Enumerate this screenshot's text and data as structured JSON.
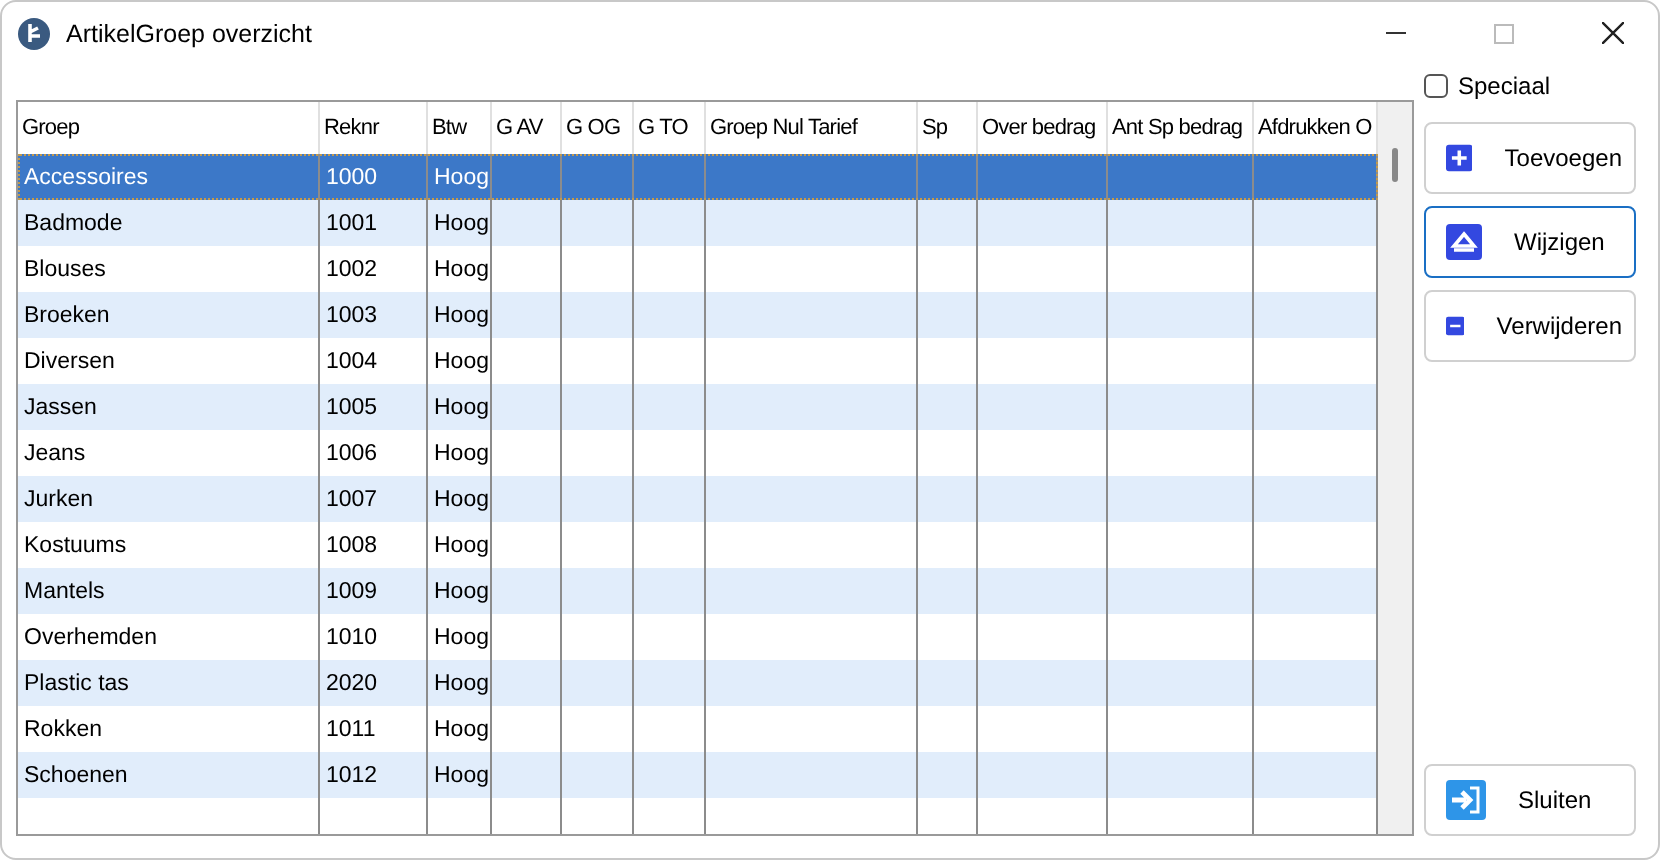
{
  "window": {
    "title": "ArtikelGroep overzicht"
  },
  "table": {
    "columns": [
      "Groep",
      "Reknr",
      "Btw",
      "G AV",
      "G OG",
      "G TO",
      "Groep Nul Tarief",
      "Sp",
      "Over bedrag",
      "Ant Sp bedrag",
      "Afdrukken O"
    ],
    "rows": [
      {
        "cells": [
          "Accessoires",
          "1000",
          "Hoog"
        ],
        "selected": true
      },
      {
        "cells": [
          "Badmode",
          "1001",
          "Hoog"
        ],
        "selected": false
      },
      {
        "cells": [
          "Blouses",
          "1002",
          "Hoog"
        ],
        "selected": false
      },
      {
        "cells": [
          "Broeken",
          "1003",
          "Hoog"
        ],
        "selected": false
      },
      {
        "cells": [
          "Diversen",
          "1004",
          "Hoog"
        ],
        "selected": false
      },
      {
        "cells": [
          "Jassen",
          "1005",
          "Hoog"
        ],
        "selected": false
      },
      {
        "cells": [
          "Jeans",
          "1006",
          "Hoog"
        ],
        "selected": false
      },
      {
        "cells": [
          "Jurken",
          "1007",
          "Hoog"
        ],
        "selected": false
      },
      {
        "cells": [
          "Kostuums",
          "1008",
          "Hoog"
        ],
        "selected": false
      },
      {
        "cells": [
          "Mantels",
          "1009",
          "Hoog"
        ],
        "selected": false
      },
      {
        "cells": [
          "Overhemden",
          "1010",
          "Hoog"
        ],
        "selected": false
      },
      {
        "cells": [
          "Plastic tas",
          "2020",
          "Hoog"
        ],
        "selected": false
      },
      {
        "cells": [
          "Rokken",
          "1011",
          "Hoog"
        ],
        "selected": false
      },
      {
        "cells": [
          "Schoenen",
          "1012",
          "Hoog"
        ],
        "selected": false
      }
    ]
  },
  "special_checkbox": {
    "label": "Speciaal",
    "checked": false
  },
  "buttons": [
    {
      "label": "Toevoegen",
      "kind": "add",
      "focused": false
    },
    {
      "label": "Wijzigen",
      "kind": "edit",
      "focused": true
    },
    {
      "label": "Verwijderen",
      "kind": "remove",
      "focused": false
    }
  ],
  "close_button": {
    "label": "Sluiten",
    "kind": "exit"
  }
}
